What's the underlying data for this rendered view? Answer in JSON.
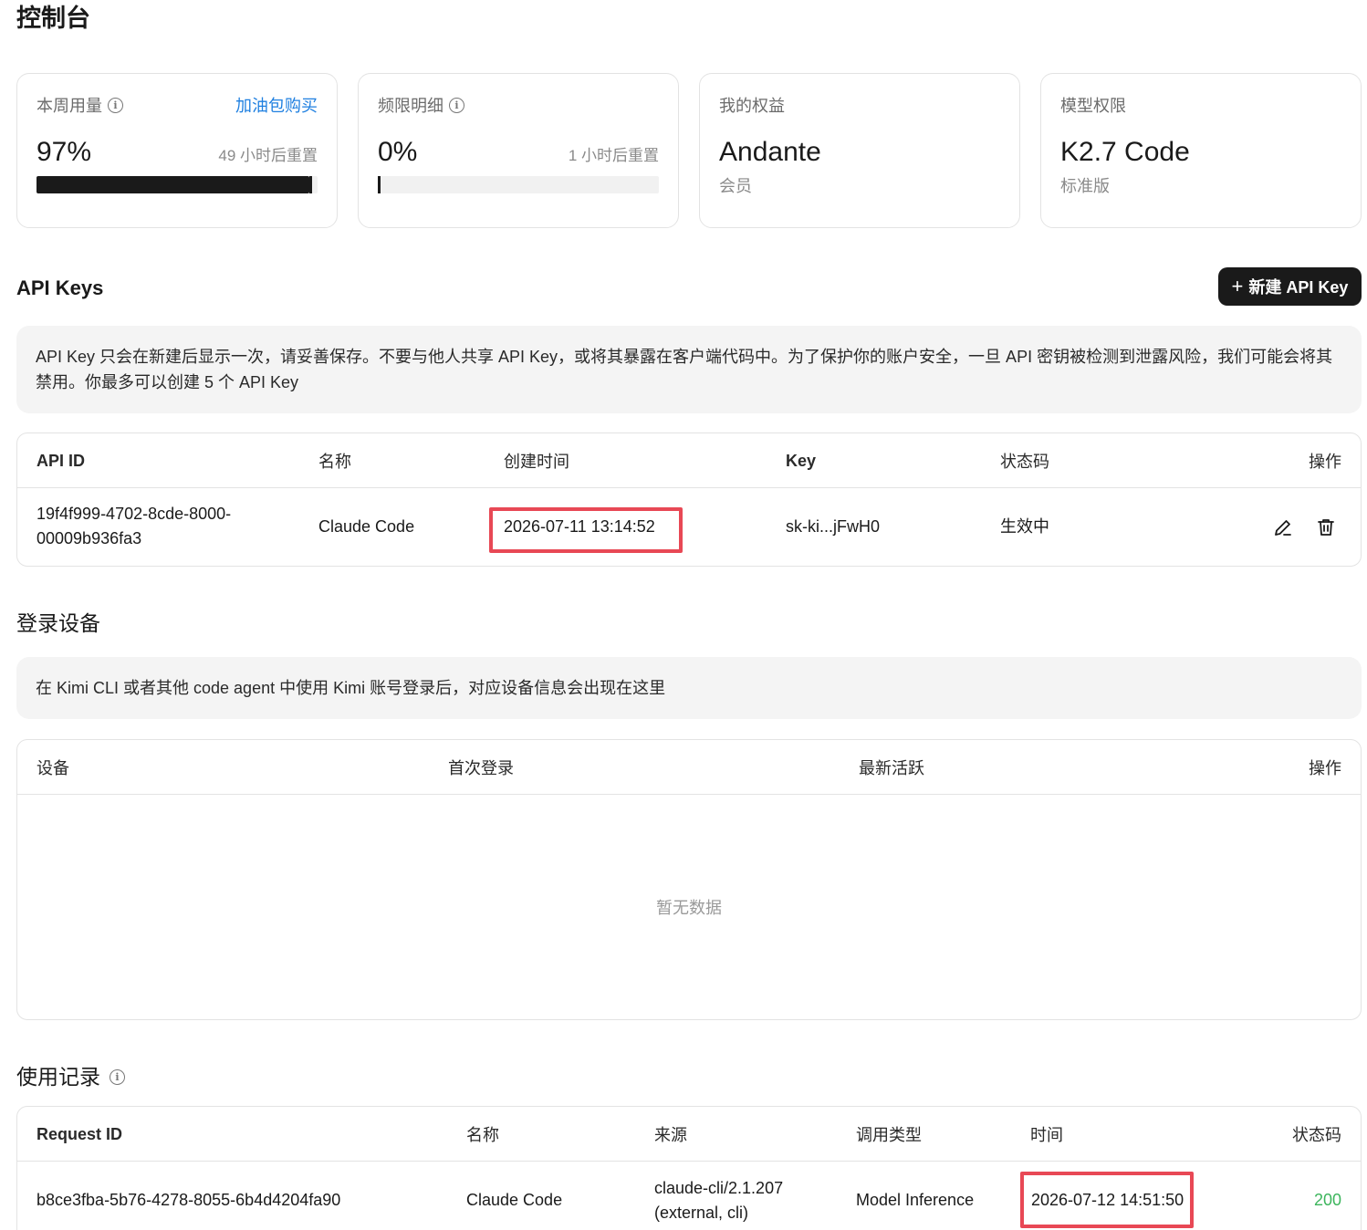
{
  "page": {
    "title": "控制台"
  },
  "cards": [
    {
      "label": "本周用量",
      "has_info": true,
      "link": "加油包购买",
      "value": "97%",
      "reset": "49 小时后重置",
      "progress": 0.97
    },
    {
      "label": "频限明细",
      "has_info": true,
      "value": "0%",
      "reset": "1 小时后重置",
      "progress": 0.0
    },
    {
      "label": "我的权益",
      "value": "Andante",
      "sub": "会员"
    },
    {
      "label": "模型权限",
      "value": "K2.7 Code",
      "sub": "标准版"
    }
  ],
  "api_keys": {
    "title": "API Keys",
    "new_button": "新建 API Key",
    "notice": "API Key 只会在新建后显示一次，请妥善保存。不要与他人共享 API Key，或将其暴露在客户端代码中。为了保护你的账户安全，一旦 API 密钥被检测到泄露风险，我们可能会将其禁用。你最多可以创建 5 个 API Key",
    "columns": {
      "id": "API ID",
      "name": "名称",
      "created": "创建时间",
      "key": "Key",
      "status": "状态码",
      "actions": "操作"
    },
    "rows": [
      {
        "id_line1": "19f4f999-4702-8cde-8000-",
        "id_line2": "00009b936fa3",
        "name": "Claude Code",
        "created": "2026-07-11 13:14:52",
        "key": "sk-ki...jFwH0",
        "status": "生效中"
      }
    ]
  },
  "devices": {
    "title": "登录设备",
    "notice": "在 Kimi CLI 或者其他 code agent 中使用 Kimi 账号登录后，对应设备信息会出现在这里",
    "columns": {
      "device": "设备",
      "first_login": "首次登录",
      "last_active": "最新活跃",
      "actions": "操作"
    },
    "empty": "暂无数据"
  },
  "usage": {
    "title": "使用记录",
    "columns": {
      "request_id": "Request ID",
      "name": "名称",
      "source": "来源",
      "call_type": "调用类型",
      "time": "时间",
      "status": "状态码"
    },
    "rows": [
      {
        "request_id": "b8ce3fba-5b76-4278-8055-6b4d4204fa90",
        "name": "Claude Code",
        "source_line1": "claude-cli/2.1.207",
        "source_line2": "(external, cli)",
        "call_type": "Model Inference",
        "time": "2026-07-12 14:51:50",
        "status": "200"
      }
    ]
  },
  "colors": {
    "accent_link": "#1e7fe0",
    "highlight": "#e84855",
    "success": "#3cb55c",
    "button_bg": "#1a1a1a"
  }
}
